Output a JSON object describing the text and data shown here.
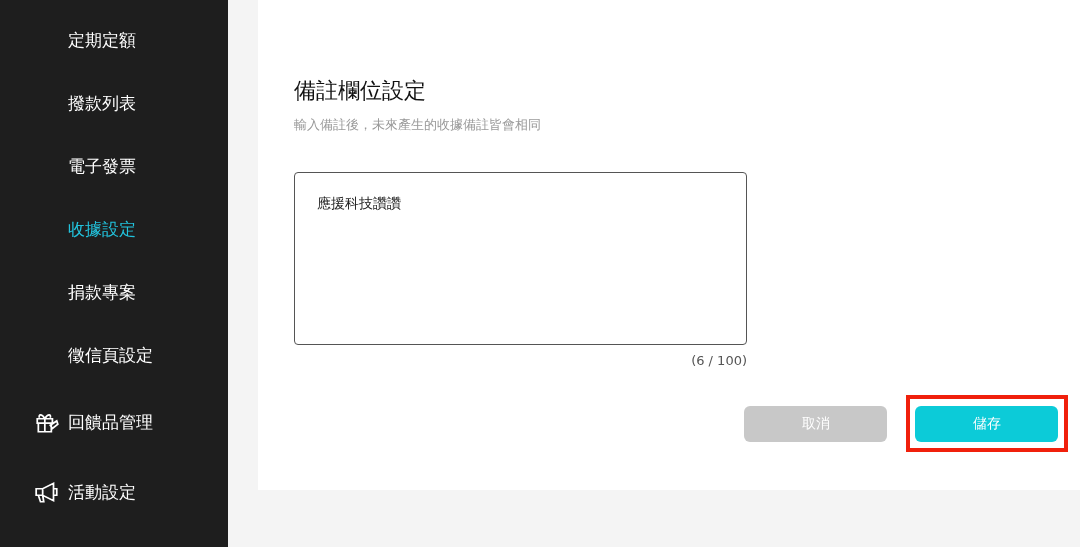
{
  "sidebar": {
    "items": [
      {
        "label": "定期定額",
        "kind": "sub",
        "selected": false
      },
      {
        "label": "撥款列表",
        "kind": "sub",
        "selected": false
      },
      {
        "label": "電子發票",
        "kind": "sub",
        "selected": false
      },
      {
        "label": "收據設定",
        "kind": "sub",
        "selected": true
      },
      {
        "label": "捐款專案",
        "kind": "sub",
        "selected": false
      },
      {
        "label": "徵信頁設定",
        "kind": "sub",
        "selected": false
      },
      {
        "label": "回饋品管理",
        "kind": "gift",
        "selected": false
      },
      {
        "label": "活動設定",
        "kind": "megaphone",
        "selected": false
      }
    ]
  },
  "form": {
    "title": "備註欄位設定",
    "subtitle": "輸入備註後，未來產生的收據備註皆會相同",
    "note": {
      "value": "應援科技讚讚",
      "counter": "(6 / 100)"
    },
    "buttons": [
      {
        "label": "取消",
        "kind": "cancel",
        "highlighted": false
      },
      {
        "label": "儲存",
        "kind": "save",
        "highlighted": true
      }
    ]
  }
}
